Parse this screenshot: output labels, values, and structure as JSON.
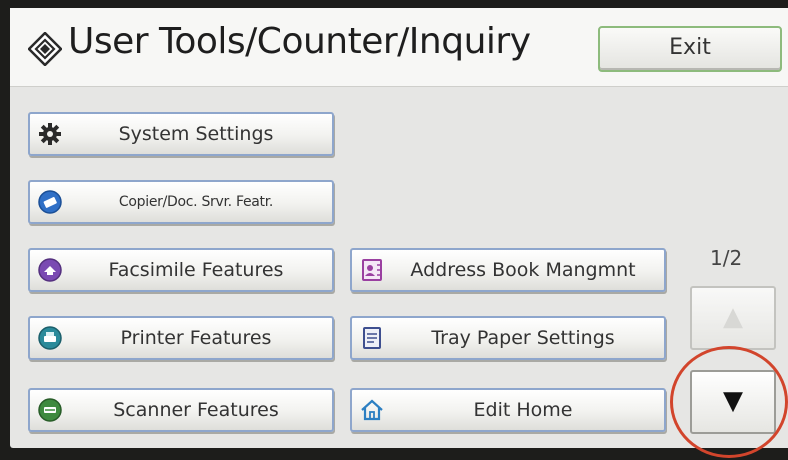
{
  "header": {
    "title": "User Tools/Counter/Inquiry",
    "exit_label": "Exit",
    "title_icon": "user-tools-diamond-icon"
  },
  "left_buttons": [
    {
      "label": "System Settings",
      "icon": "gear-icon"
    },
    {
      "label": "Copier/Doc. Srvr. Featr.",
      "icon": "copier-icon"
    },
    {
      "label": "Facsimile Features",
      "icon": "fax-icon"
    },
    {
      "label": "Printer Features",
      "icon": "printer-icon"
    },
    {
      "label": "Scanner Features",
      "icon": "scanner-icon"
    }
  ],
  "right_buttons": [
    {
      "label": "Address Book Mangmnt",
      "icon": "address-book-icon"
    },
    {
      "label": "Tray Paper Settings",
      "icon": "tray-paper-icon"
    },
    {
      "label": "Edit Home",
      "icon": "home-icon"
    }
  ],
  "pagination": {
    "indicator": "1/2",
    "up_icon": "▲",
    "down_icon": "▼"
  },
  "colors": {
    "button_border": "#8ea6cc",
    "exit_border": "#8dbb7c",
    "highlight_circle": "#d2452c",
    "system_icon": "#2a2a2a",
    "copier_icon": "#2f6fc6",
    "fax_icon": "#7a4ab2",
    "printer_icon": "#2a8a9a",
    "scanner_icon": "#3f8a3f",
    "address_book_icon": "#9a3fa0",
    "tray_icon": "#3e4f8f",
    "home_icon": "#2c7fc2"
  }
}
